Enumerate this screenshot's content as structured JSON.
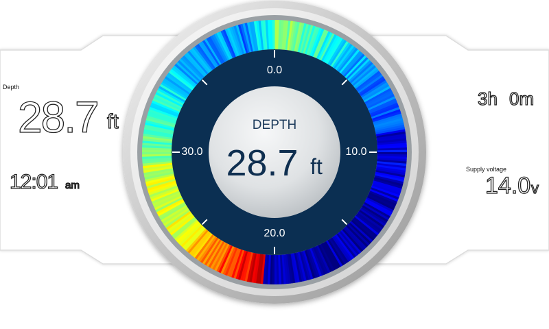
{
  "left_panel": {
    "depth_label": "Depth",
    "depth_value": "28.7",
    "depth_unit": "ft",
    "time_value": "12:01",
    "time_suffix": "am"
  },
  "right_panel": {
    "duration_hours": "3h",
    "duration_minutes": "0m",
    "voltage_label": "Supply voltage",
    "voltage_value": "14.0",
    "voltage_unit": "v"
  },
  "gauge": {
    "title": "DEPTH",
    "value": "28.7",
    "unit": "ft",
    "tick_labels": {
      "top": "0.0",
      "right": "10.0",
      "bottom": "20.0",
      "left": "30.0"
    },
    "colors": {
      "face_dark": "#0b2f52",
      "bezel": "#c9c9c9",
      "center_light": "#e3e6e8"
    }
  }
}
